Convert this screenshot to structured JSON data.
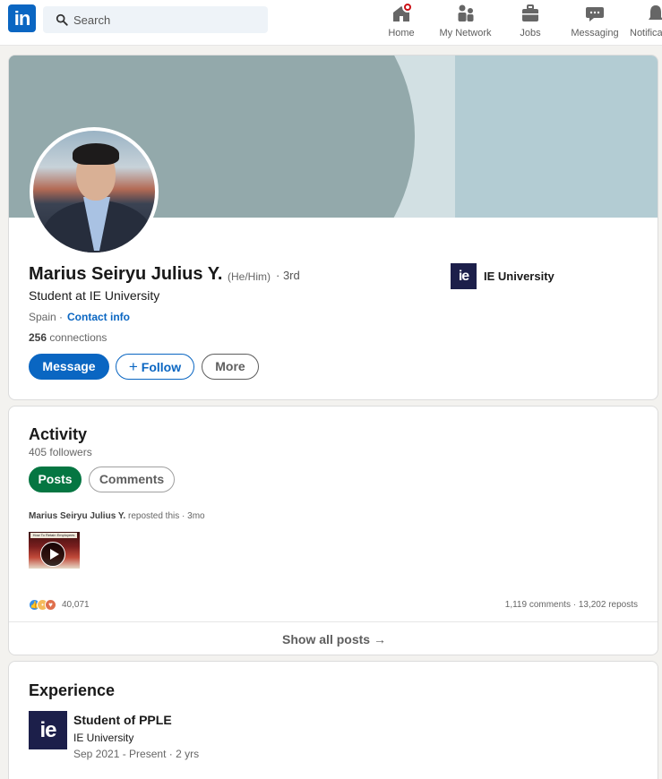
{
  "nav": {
    "logo_text": "in",
    "search_placeholder": "Search",
    "items": [
      {
        "label": "Home",
        "icon": "home-icon"
      },
      {
        "label": "My Network",
        "icon": "people-icon"
      },
      {
        "label": "Jobs",
        "icon": "briefcase-icon"
      },
      {
        "label": "Messaging",
        "icon": "chat-icon"
      },
      {
        "label": "Notifications",
        "icon": "bell-icon"
      }
    ]
  },
  "profile": {
    "name": "Marius Seiryu Julius Y.",
    "pronouns": "(He/Him)",
    "degree": "· 3rd",
    "headline": "Student at IE University",
    "location": "Spain ·",
    "contact_label": "Contact info",
    "connections_count": "256",
    "connections_label": "connections",
    "university_logo_text": "ie",
    "university_name": "IE University",
    "buttons": {
      "message": "Message",
      "follow": "Follow",
      "more": "More"
    }
  },
  "activity": {
    "title": "Activity",
    "followers": "405 followers",
    "tabs": [
      "Posts",
      "Comments"
    ],
    "post": {
      "author": "Marius Seiryu Julius Y.",
      "action": "reposted this · 3mo",
      "thumbnail_caption": "How To Retain Employees",
      "reactions_count": "40,071",
      "stats": "1,119 comments · 13,202 reposts"
    },
    "show_all": "Show all posts →"
  },
  "experience": {
    "title": "Experience",
    "items": [
      {
        "logo_text": "ie",
        "role": "Student of PPLE",
        "organization": "IE University",
        "dates": "Sep 2021 - Present · 2 yrs"
      }
    ]
  },
  "colors": {
    "brand_blue": "#0a66c2",
    "active_green": "#057642",
    "ie_navy": "#1c1f4a",
    "notification_red": "#cc1016"
  }
}
